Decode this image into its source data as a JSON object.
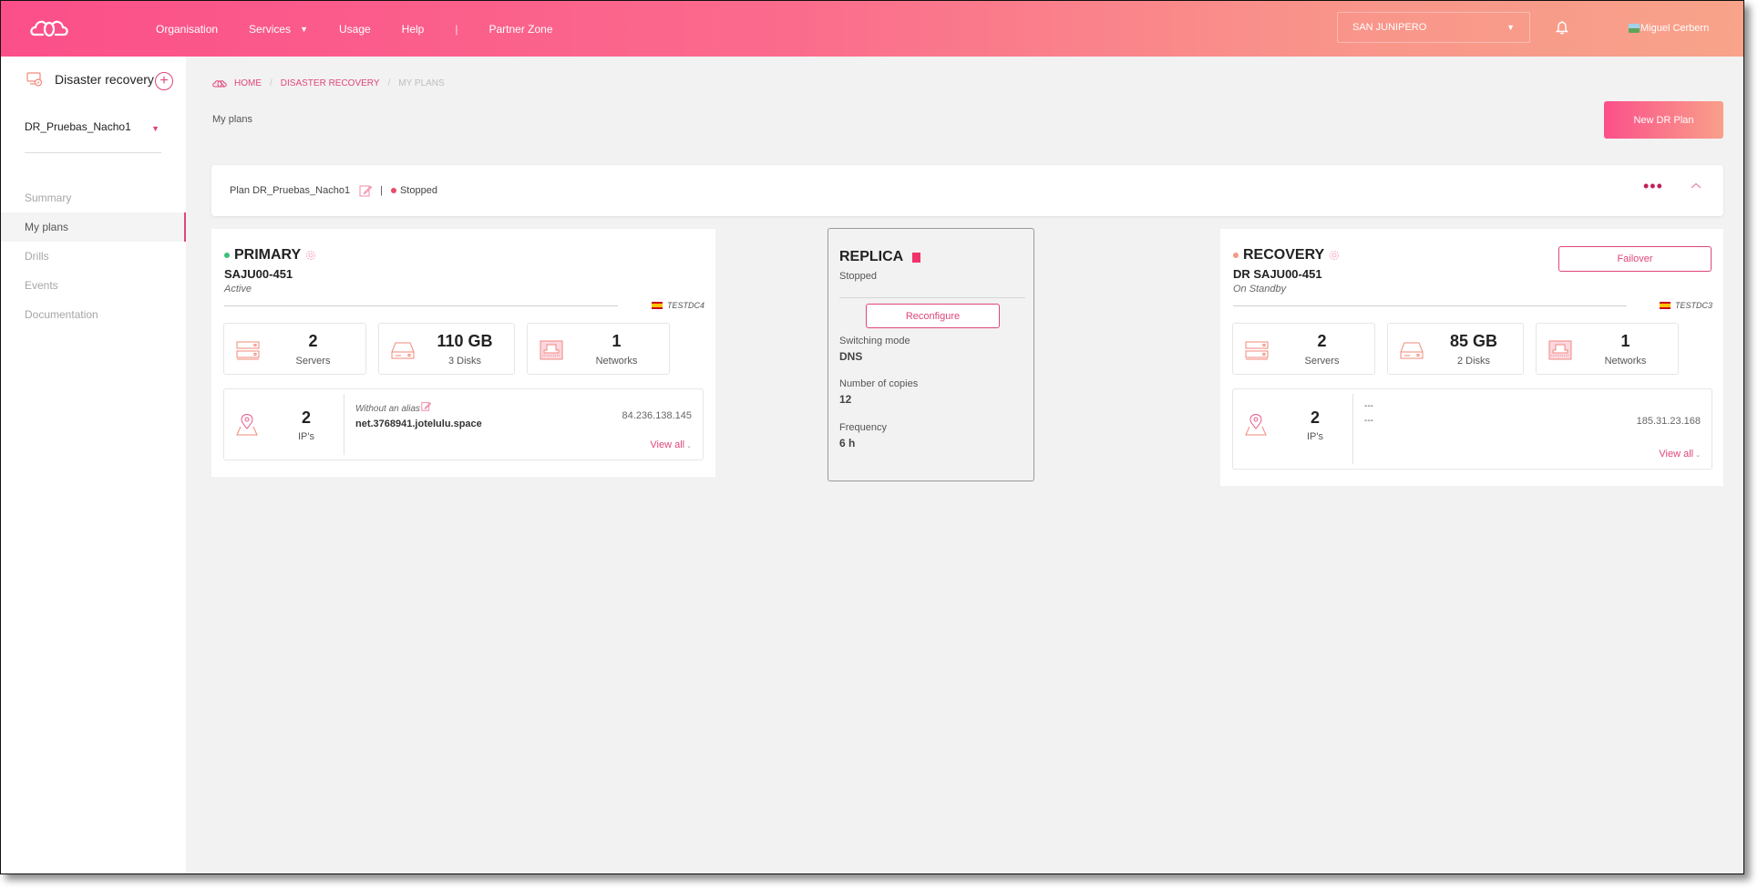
{
  "header": {
    "logo": "cloud-logo",
    "nav": [
      {
        "label": "Organisation"
      },
      {
        "label": "Services",
        "has_caret": true
      },
      {
        "label": "Usage"
      },
      {
        "label": "Help"
      },
      {
        "label": "Partner Zone"
      }
    ],
    "nav_separator": "|",
    "org_select": {
      "value": "SAN JUNIPERO",
      "caret": "▼"
    },
    "notifications_icon": "bell-icon",
    "user_name": "Miguel Cerbern"
  },
  "sidebar": {
    "title": "Disaster recovery",
    "title_icon": "disaster-recovery-icon",
    "add_label": "+",
    "plan_select": {
      "value": "DR_Pruebas_Nacho1",
      "caret": "▼"
    },
    "items": [
      {
        "label": "Summary",
        "active": false
      },
      {
        "label": "My plans",
        "active": true
      },
      {
        "label": "Drills",
        "active": false
      },
      {
        "label": "Events",
        "active": false
      },
      {
        "label": "Documentation",
        "active": false
      }
    ]
  },
  "breadcrumb": {
    "items": [
      "HOME",
      "DISASTER RECOVERY",
      "MY PLANS"
    ],
    "separator": "/"
  },
  "page_title": "My plans",
  "new_plan_button": "New DR Plan",
  "plan": {
    "name": "Plan DR_Pruebas_Nacho1",
    "separator": "|",
    "status": "Stopped",
    "status_color": "#e84a6a",
    "more_label": "•••"
  },
  "primary": {
    "role": "PRIMARY",
    "dot_color": "#3cc17c",
    "name": "SAJU00-451",
    "status": "Active",
    "datacenter": "TESTDC4",
    "servers": {
      "value": "2",
      "label": "Servers"
    },
    "storage": {
      "value": "110 GB",
      "label": "3 Disks"
    },
    "networks": {
      "value": "1",
      "label": "Networks"
    },
    "ips": {
      "count": "2",
      "label": "IP's",
      "alias": "Without an alias",
      "dns_name": "net.3768941.jotelulu.space",
      "address": "84.236.138.145",
      "view_all": "View all",
      "view_all_chevron": "⌄"
    }
  },
  "replica": {
    "title": "REPLICA",
    "status": "Stopped",
    "status_color": "#f0346b",
    "reconfigure_label": "Reconfigure",
    "switching_mode_label": "Switching mode",
    "switching_mode": "DNS",
    "copies_label": "Number of copies",
    "copies": "12",
    "frequency_label": "Frequency",
    "frequency": "6 h"
  },
  "recovery": {
    "role": "RECOVERY",
    "dot_color": "#f29a84",
    "name": "DR SAJU00-451",
    "status": "On Standby",
    "datacenter": "TESTDC3",
    "failover_label": "Failover",
    "servers": {
      "value": "2",
      "label": "Servers"
    },
    "storage": {
      "value": "85 GB",
      "label": "2 Disks"
    },
    "networks": {
      "value": "1",
      "label": "Networks"
    },
    "ips": {
      "count": "2",
      "label": "IP's",
      "line1": "---",
      "line2": "---",
      "address": "185.31.23.168",
      "view_all": "View all",
      "view_all_chevron": "⌄"
    }
  },
  "colors": {
    "accent": "#e0467a",
    "header_gradient_start": "#fb4f8a",
    "header_gradient_end": "#f8a38a",
    "background": "#f2f2f2"
  }
}
